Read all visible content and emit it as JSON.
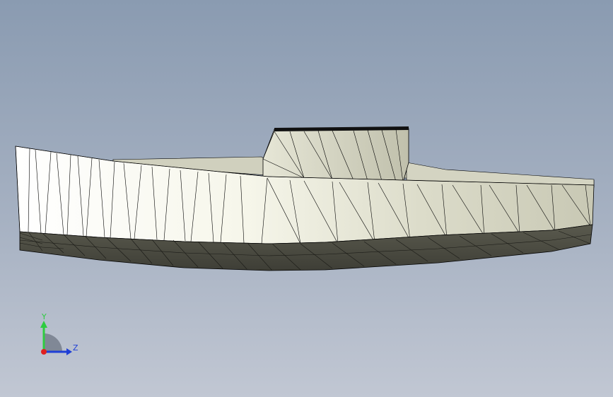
{
  "viewport": {
    "background_top": "#8a9bb1",
    "background_bottom": "#c1c7d3"
  },
  "model": {
    "shape": "boat-hull-mesh",
    "mesh_color": "#000000",
    "side_light": "#ffffff",
    "side_shade": "#c9c8b4",
    "bottom_color": "#4d4d43"
  },
  "triad": {
    "y_label": "Y",
    "z_label": "Z",
    "y_color": "#2ecc40",
    "z_color": "#1f3fd6",
    "x_color": "#e02020"
  }
}
